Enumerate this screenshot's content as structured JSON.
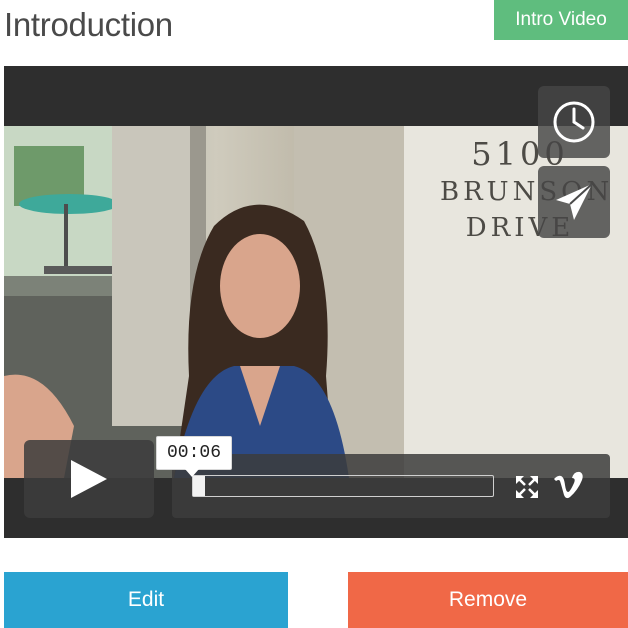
{
  "page": {
    "title": "Introduction",
    "badge": "Intro Video"
  },
  "video": {
    "wall_sign": [
      "5100",
      "BRUNSON",
      "DRIVE"
    ],
    "tooltip_time": "00:06",
    "progress": 0.04,
    "side_icons": [
      "clock-icon",
      "send-icon"
    ],
    "control_icons": [
      "play-icon",
      "fullscreen-icon",
      "vimeo-icon"
    ]
  },
  "actions": {
    "edit_label": "Edit",
    "remove_label": "Remove"
  },
  "colors": {
    "badge": "#5fbd7e",
    "edit": "#2aa3d1",
    "remove": "#f06847",
    "player_bg": "#2e2e2e"
  }
}
